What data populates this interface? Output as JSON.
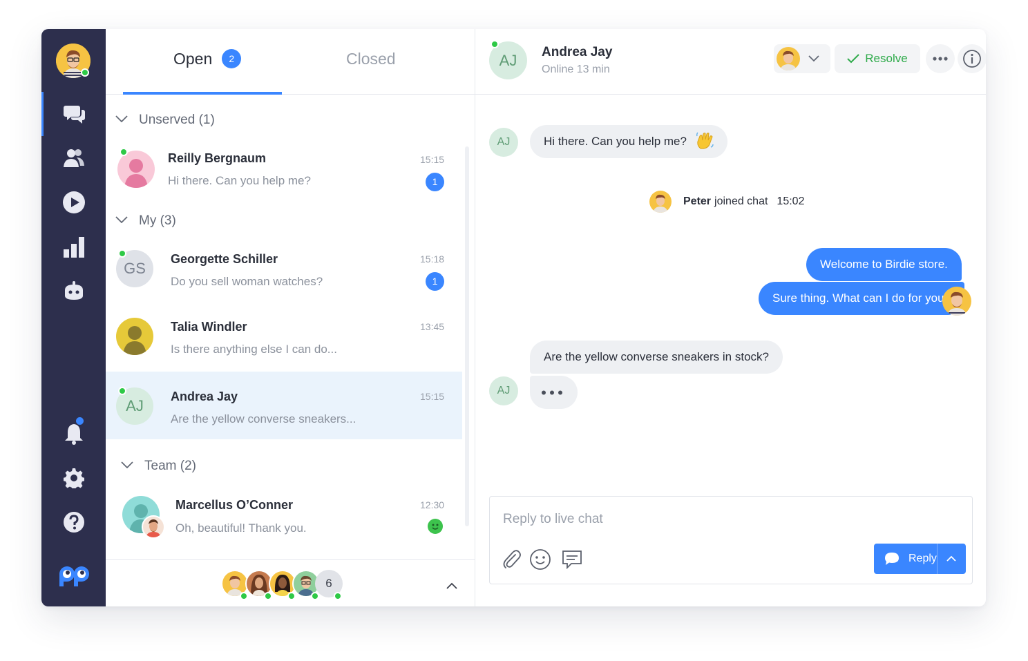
{
  "sidebar": {
    "items": [
      {
        "icon": "chat-bubbles-icon",
        "active": true
      },
      {
        "icon": "contacts-icon",
        "active": false
      },
      {
        "icon": "play-icon",
        "active": false
      },
      {
        "icon": "bar-chart-icon",
        "active": false
      },
      {
        "icon": "bot-icon",
        "active": false
      }
    ],
    "bottom_items": [
      "bell-icon",
      "gear-icon",
      "help-icon"
    ],
    "logo": "pp-logo"
  },
  "tabs": {
    "open_label": "Open",
    "open_count": "2",
    "closed_label": "Closed"
  },
  "sections": {
    "unserved": "Unserved (1)",
    "my": "My (3)",
    "team": "Team (2)"
  },
  "conversations": [
    {
      "name": "Reilly Bergnaum",
      "message": "Hi there. Can you help me?",
      "time": "15:15",
      "unread": "1"
    },
    {
      "name": "Georgette Schiller",
      "initials": "GS",
      "message": "Do you sell woman watches?",
      "time": "15:18",
      "unread": "1"
    },
    {
      "name": "Talia Windler",
      "message": "Is there anything else I can do...",
      "time": "13:45"
    },
    {
      "name": "Andrea Jay",
      "initials": "AJ",
      "message": "Are the yellow converse sneakers...",
      "time": "15:15"
    },
    {
      "name": "Marcellus O’Conner",
      "message": "Oh, beautiful! Thank you.",
      "time": "12:30"
    }
  ],
  "footer": {
    "team_more": "6"
  },
  "chat": {
    "header": {
      "initials": "AJ",
      "name": "Andrea Jay",
      "status": "Online 13 min"
    },
    "resolve_label": "Resolve",
    "messages": [
      {
        "from": "customer",
        "initials": "AJ",
        "text": "Hi there. Can you help me?"
      },
      {
        "from": "agent",
        "text": "Welcome to Birdie store."
      },
      {
        "from": "agent",
        "text": "Sure thing. What can I do for you?"
      },
      {
        "from": "customer",
        "initials": "AJ",
        "text": "Are the yellow converse sneakers in stock?"
      }
    ],
    "system": {
      "name": "Peter",
      "action": "joined chat",
      "time": "15:02"
    },
    "composer_placeholder": "Reply to live chat",
    "reply_label": "Reply"
  },
  "colors": {
    "accent": "#3a86ff",
    "sidebar": "#2d2f4d",
    "online": "#2ec946",
    "resolve": "#2eaa4a"
  }
}
